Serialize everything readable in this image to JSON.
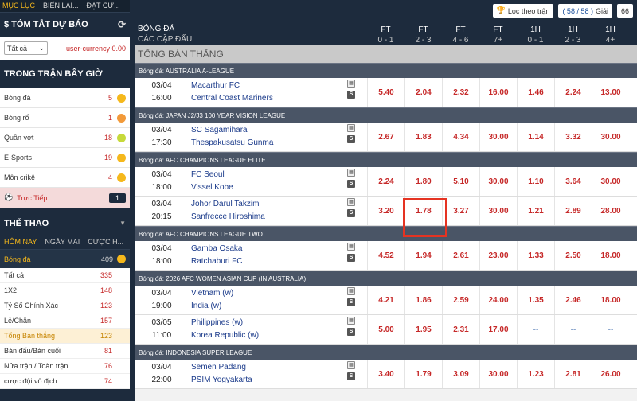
{
  "top_tabs": [
    "MỤC LỤC",
    "BIỂN LAI...",
    "ĐẶT CƯ..."
  ],
  "summary": {
    "title": "$ TÓM TẮT DỰ BÁO",
    "filter_value": "Tất cả",
    "currency": "user-currency 0.00"
  },
  "live_section": {
    "title": "TRONG TRẬN BÂY GIỜ",
    "sports": [
      {
        "label": "Bóng đá",
        "count": "5",
        "color": "#f5b81c"
      },
      {
        "label": "Bóng rổ",
        "count": "1",
        "color": "#f29a3a"
      },
      {
        "label": "Quần vợt",
        "count": "18",
        "color": "#c7d93a"
      },
      {
        "label": "E-Sports",
        "count": "19",
        "color": "#f5b81c"
      },
      {
        "label": "Môn crikê",
        "count": "4",
        "color": "#f5b81c"
      }
    ],
    "live": {
      "label": "Trực Tiếp",
      "count": "1"
    }
  },
  "sports_section": {
    "title": "THỂ THAO",
    "tabs": [
      "HÔM NAY",
      "NGÀY MAI",
      "CƯỢC H..."
    ],
    "active_sport": {
      "label": "Bóng đá",
      "count": "409"
    },
    "markets": [
      {
        "label": "Tất cả",
        "count": "335"
      },
      {
        "label": "1X2",
        "count": "148"
      },
      {
        "label": "Tỷ Số Chính Xác",
        "count": "123"
      },
      {
        "label": "Lẻ/Chẵn",
        "count": "157"
      },
      {
        "label": "Tổng Bàn thắng",
        "count": "123",
        "active": true
      },
      {
        "label": "Bán đấu/Bán cuối",
        "count": "81"
      },
      {
        "label": "Nửa trận / Toàn trận",
        "count": "76"
      },
      {
        "label": "cược đội vô địch",
        "count": "74"
      }
    ]
  },
  "header": {
    "filter_label": "Lọc theo trận",
    "games_count": "( 58 / 58 )",
    "games_label": "Giải",
    "extra": "66",
    "sport": "BÓNG ĐÁ",
    "sub": "CÁC CẶP ĐẤU",
    "columns": [
      {
        "top": "FT",
        "bottom": "0 - 1"
      },
      {
        "top": "FT",
        "bottom": "2 - 3"
      },
      {
        "top": "FT",
        "bottom": "4 - 6"
      },
      {
        "top": "FT",
        "bottom": "7+"
      },
      {
        "top": "1H",
        "bottom": "0 - 1"
      },
      {
        "top": "1H",
        "bottom": "2 - 3"
      },
      {
        "top": "1H",
        "bottom": "4+"
      }
    ]
  },
  "market_title": "TỔNG BÀN THẮNG",
  "leagues": [
    {
      "name": "Bóng đá: AUSTRALIA A-LEAGUE",
      "matches": [
        {
          "date": "03/04",
          "time": "16:00",
          "home": "Macarthur FC",
          "away": "Central Coast Mariners",
          "odds": [
            "5.40",
            "2.04",
            "2.32",
            "16.00",
            "1.46",
            "2.24",
            "13.00"
          ]
        }
      ]
    },
    {
      "name": "Bóng đá: JAPAN J2/J3 100 YEAR VISION LEAGUE",
      "matches": [
        {
          "date": "03/04",
          "time": "17:30",
          "home": "SC Sagamihara",
          "away": "Thespakusatsu Gunma",
          "odds": [
            "2.67",
            "1.83",
            "4.34",
            "30.00",
            "1.14",
            "3.32",
            "30.00"
          ]
        }
      ]
    },
    {
      "name": "Bóng đá: AFC CHAMPIONS LEAGUE ELITE",
      "matches": [
        {
          "date": "03/04",
          "time": "18:00",
          "home": "FC Seoul",
          "away": "Vissel Kobe",
          "odds": [
            "2.24",
            "1.80",
            "5.10",
            "30.00",
            "1.10",
            "3.64",
            "30.00"
          ]
        },
        {
          "date": "03/04",
          "time": "20:15",
          "home": "Johor Darul Takzim",
          "away": "Sanfrecce Hiroshima",
          "odds": [
            "3.20",
            "1.78",
            "3.27",
            "30.00",
            "1.21",
            "2.89",
            "28.00"
          ]
        }
      ]
    },
    {
      "name": "Bóng đá: AFC CHAMPIONS LEAGUE TWO",
      "matches": [
        {
          "date": "03/04",
          "time": "18:00",
          "home": "Gamba Osaka",
          "away": "Ratchaburi FC",
          "odds": [
            "4.52",
            "1.94",
            "2.61",
            "23.00",
            "1.33",
            "2.50",
            "18.00"
          ]
        }
      ]
    },
    {
      "name": "Bóng đá: 2026 AFC WOMEN ASIAN CUP (IN AUSTRALIA)",
      "matches": [
        {
          "date": "03/04",
          "time": "19:00",
          "home": "Vietnam (w)",
          "away": "India (w)",
          "odds": [
            "4.21",
            "1.86",
            "2.59",
            "24.00",
            "1.35",
            "2.46",
            "18.00"
          ]
        },
        {
          "date": "03/05",
          "time": "11:00",
          "home": "Philippines (w)",
          "away": "Korea Republic (w)",
          "odds": [
            "5.00",
            "1.95",
            "2.31",
            "17.00",
            "--",
            "--",
            "--"
          ]
        }
      ]
    },
    {
      "name": "Bóng đá: INDONESIA SUPER LEAGUE",
      "matches": [
        {
          "date": "03/04",
          "time": "22:00",
          "home": "Semen Padang",
          "away": "PSIM Yogyakarta",
          "odds": [
            "3.40",
            "1.79",
            "3.09",
            "30.00",
            "1.23",
            "2.81",
            "26.00"
          ]
        }
      ]
    }
  ]
}
